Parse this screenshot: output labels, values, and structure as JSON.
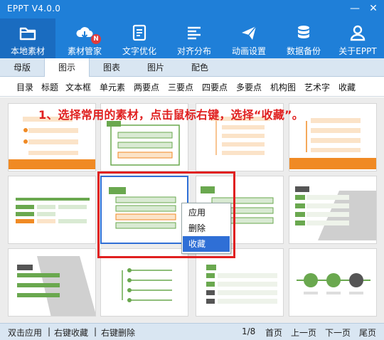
{
  "window": {
    "title": "EPPT V4.0.0",
    "minimize_glyph": "—",
    "close_glyph": "✕"
  },
  "toolbar": {
    "items": [
      {
        "label": "本地素材",
        "icon": "folder-icon"
      },
      {
        "label": "素材管家",
        "icon": "cloud-download-icon",
        "badge": "N"
      },
      {
        "label": "文字优化",
        "icon": "document-icon"
      },
      {
        "label": "对齐分布",
        "icon": "align-icon"
      },
      {
        "label": "动画设置",
        "icon": "paper-plane-icon"
      },
      {
        "label": "数据备份",
        "icon": "database-icon"
      },
      {
        "label": "关于EPPT",
        "icon": "user-icon"
      }
    ],
    "active_index": 0
  },
  "tabs": {
    "items": [
      "母版",
      "图示",
      "图表",
      "图片",
      "配色"
    ],
    "active_index": 1
  },
  "subcategories": [
    "目录",
    "标题",
    "文本框",
    "单元素",
    "两要点",
    "三要点",
    "四要点",
    "多要点",
    "机构图",
    "艺术字",
    "收藏"
  ],
  "annotation": {
    "instruction": "1、选择常用的素材，点击鼠标右键，选择“收藏”。"
  },
  "context_menu": {
    "items": [
      "应用",
      "删除",
      "收藏"
    ],
    "highlighted_index": 2
  },
  "status": {
    "hint_apply": "双击应用",
    "separator": "|",
    "hint_favorite": "右键收藏",
    "hint_delete": "右键删除",
    "page_indicator": "1/8",
    "first_page": "首页",
    "prev_page": "上一页",
    "next_page": "下一页",
    "last_page": "尾页"
  },
  "colors": {
    "brand_blue": "#1f7fd8",
    "accent_green": "#6aa84f",
    "accent_orange": "#f08a24",
    "annotation_red": "#e02020",
    "selection_blue": "#2f6fd6"
  }
}
